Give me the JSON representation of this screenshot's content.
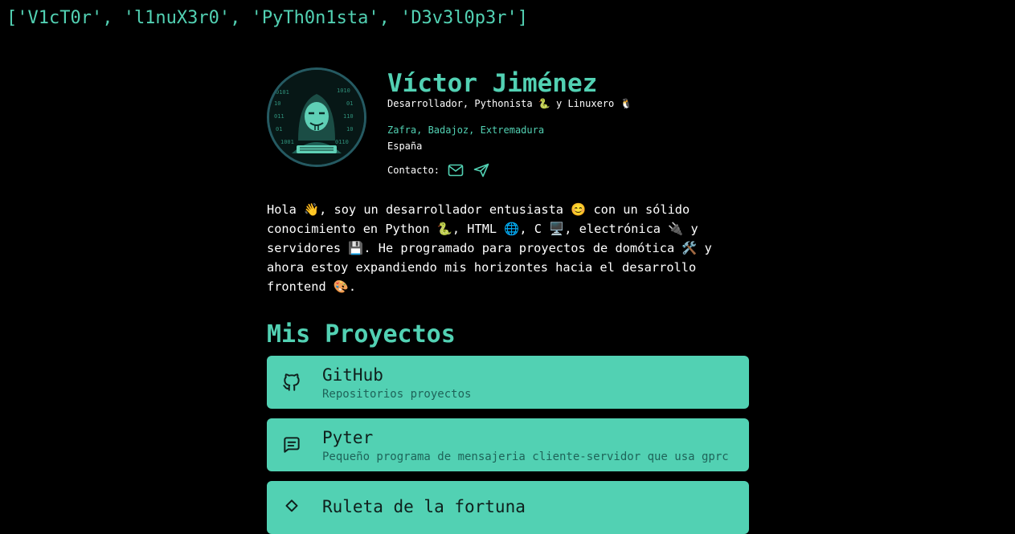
{
  "banner": {
    "text": "['V1cT0r', 'l1nuX3r0', 'PyTh0n1sta', 'D3v3l0p3r']"
  },
  "profile": {
    "name": "Víctor Jiménez",
    "tagline": "Desarrollador, Pythonista 🐍 y Linuxero 🐧",
    "city": "Zafra, Badajoz, Extremadura",
    "country": "España",
    "contact_label": "Contacto:",
    "contact_icons": [
      "mail-icon",
      "send-icon"
    ],
    "avatar_icon": "hacker-avatar"
  },
  "bio": {
    "text": "Hola 👋, soy un desarrollador entusiasta 😊 con un sólido conocimiento en Python 🐍, HTML 🌐, C 🖥️, electrónica 🔌 y servidores 💾. He programado para proyectos de domótica 🛠️ y ahora estoy expandiendo mis horizontes hacia el desarrollo frontend 🎨."
  },
  "projects": {
    "title": "Mis Proyectos",
    "items": [
      {
        "title": "GitHub",
        "description": "Repositorios proyectos",
        "icon": "github-icon"
      },
      {
        "title": "Pyter",
        "description": "Pequeño programa de mensajeria cliente-servidor que usa gprc",
        "icon": "message-icon"
      },
      {
        "title": "Ruleta de la fortuna",
        "description": "",
        "icon": "wheel-icon"
      }
    ]
  },
  "colors": {
    "background": "#000000",
    "accent": "#52d1b3",
    "card_text": "#0f1f1c",
    "card_desc": "#1e6459",
    "avatar_ring": "#255a62"
  }
}
